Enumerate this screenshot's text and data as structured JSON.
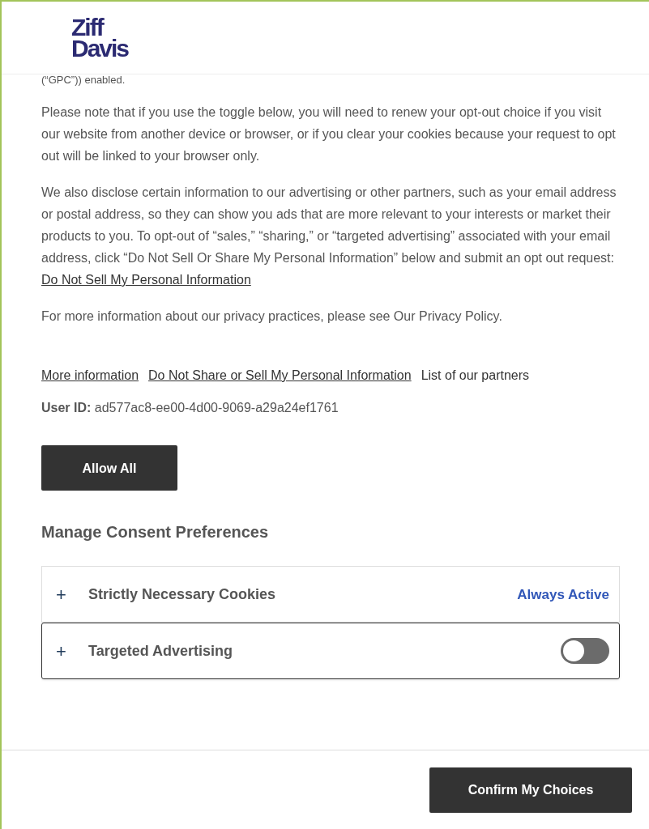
{
  "logo": {
    "line_1": "Ziff",
    "line_2": "Davis"
  },
  "partial_line": "(“GPC”)) enabled.",
  "paragraphs": [
    "Please note that if you use the toggle below, you will need to renew your opt-out choice if you visit our website from another device or browser, or if you clear your cookies because your request to opt out will be linked to your browser only.",
    "We also disclose certain information to our advertising or other partners, such as your email address or postal address, so they can show you ads that are more relevant to your interests or market their products to you. To opt-out of “sales,” “sharing,” or “targeted advertising” associated with your email address, click “Do Not Sell Or Share My Personal Information” below and submit an opt out request:",
    "For more information about our privacy practices, please see Our Privacy Policy."
  ],
  "inline_link": "Do Not Sell My Personal Information",
  "links": [
    {
      "label": "More information",
      "underlined": true
    },
    {
      "label": "Do Not Share or Sell My Personal Information",
      "underlined": true
    },
    {
      "label": "List of our partners",
      "underlined": false
    }
  ],
  "user_id": {
    "label": "User ID:",
    "value": "ad577ac8-ee00-4d00-9069-a29a24ef1761"
  },
  "allow_all_button": "Allow All",
  "section_title": "Manage Consent Preferences",
  "categories": [
    {
      "kind": "always_active",
      "expander": "+",
      "label": "Strictly Necessary Cookies",
      "status": "Always Active"
    },
    {
      "kind": "toggle",
      "expander": "+",
      "label": "Targeted Advertising",
      "on": false
    }
  ],
  "confirm_button": "Confirm My Choices"
}
